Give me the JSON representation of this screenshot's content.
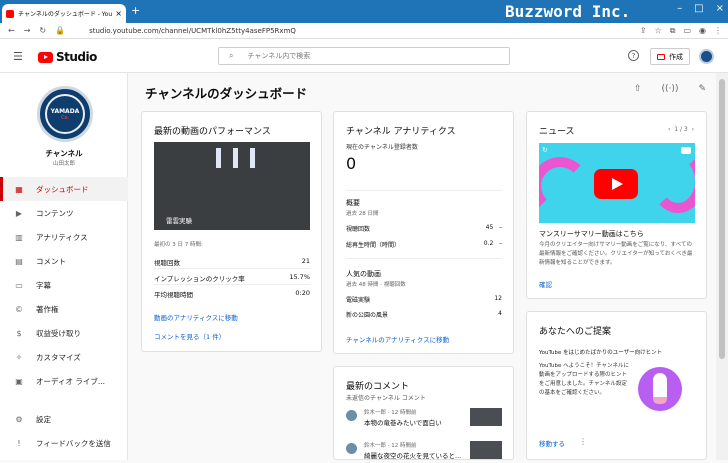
{
  "browser": {
    "tab_title": "チャンネルのダッシュボード - YouTube",
    "tab_close": "×",
    "new_tab": "+",
    "brand": "Buzzword Inc.",
    "url": "studio.youtube.com/channel/UCMTkl0hZ5tty4aseFP5RxmQ",
    "window_controls": [
      "–",
      "□",
      "×"
    ]
  },
  "header": {
    "logo_text": "Studio",
    "search_placeholder": "チャンネル内で検索",
    "help": "?",
    "create_label": "作成"
  },
  "channel": {
    "avatar_text": "YAMADA",
    "avatar_sub": "Co.",
    "name": "チャンネル",
    "owner": "山田太郎"
  },
  "sidebar": {
    "items": [
      {
        "label": "ダッシュボード",
        "icon": "dashboard-icon",
        "active": true
      },
      {
        "label": "コンテンツ",
        "icon": "content-icon"
      },
      {
        "label": "アナリティクス",
        "icon": "analytics-icon"
      },
      {
        "label": "コメント",
        "icon": "comment-icon"
      },
      {
        "label": "字幕",
        "icon": "subtitles-icon"
      },
      {
        "label": "著作権",
        "icon": "copyright-icon"
      },
      {
        "label": "収益受け取り",
        "icon": "dollar-icon"
      },
      {
        "label": "カスタマイズ",
        "icon": "magic-wand-icon"
      },
      {
        "label": "オーディオ ライブ...",
        "icon": "audio-library-icon"
      }
    ],
    "bottom": [
      {
        "label": "設定",
        "icon": "gear-icon"
      },
      {
        "label": "フィードバックを送信",
        "icon": "feedback-icon"
      }
    ]
  },
  "main": {
    "title": "チャンネルのダッシュボード"
  },
  "latest_video": {
    "heading": "最新の動画のパフォーマンス",
    "video_title": "雷雲実験",
    "meta": "最初の 3 日 7 時間:",
    "rows": [
      {
        "label": "視聴回数",
        "value": "21"
      },
      {
        "label": "インプレッションのクリック率",
        "value": "15.7%"
      },
      {
        "label": "平均視聴時間",
        "value": "0:20"
      }
    ],
    "link_analytics": "動画のアナリティクスに移動",
    "link_comments": "コメントを見る（1 件）"
  },
  "channel_analytics": {
    "heading": "チャンネル アナリティクス",
    "subs_label": "現在のチャンネル登録者数",
    "subs_value": "0",
    "summary_title": "概要",
    "summary_sub": "過去 28 日間",
    "summary_rows": [
      {
        "label": "視聴回数",
        "value": "45",
        "trend": "–"
      },
      {
        "label": "総再生時間（時間）",
        "value": "0.2",
        "trend": "–"
      }
    ],
    "popular_title": "人気の動画",
    "popular_sub": "過去 48 時間 · 視聴回数",
    "popular_rows": [
      {
        "label": "電磁実験",
        "value": "12"
      },
      {
        "label": "新の公園の風景",
        "value": "4"
      }
    ],
    "link": "チャンネルのアナリティクスに移動"
  },
  "latest_comments": {
    "heading": "最新のコメント",
    "sub": "未返信のチャンネル コメント",
    "items": [
      {
        "who": "鈴木一郎 · 12 時間前",
        "text": "本物の竜巻みたいで面白い"
      },
      {
        "who": "鈴木一郎 · 12 時間前",
        "text": "綺麗な夜空の花火を見ていると..."
      }
    ]
  },
  "news": {
    "heading": "ニュース",
    "pager": "1 / 3",
    "title": "マンスリーサマリー動画はこちら",
    "body": "今月のクリエイター向けサマリー動画をご覧になり、すべての最新情報をご確認ください。クリエイターが知っておくべき最新情報を知ることができます。",
    "link": "確認"
  },
  "suggestions": {
    "heading": "あなたへのご提案",
    "sub": "YouTube をはじめたばかりのユーザー向けヒント",
    "body": "YouTube へようこそ！チャンネルに動画をアップロードする際のヒントをご用意しました。チャンネル設定の基本をご確認ください。",
    "link": "移動する"
  }
}
